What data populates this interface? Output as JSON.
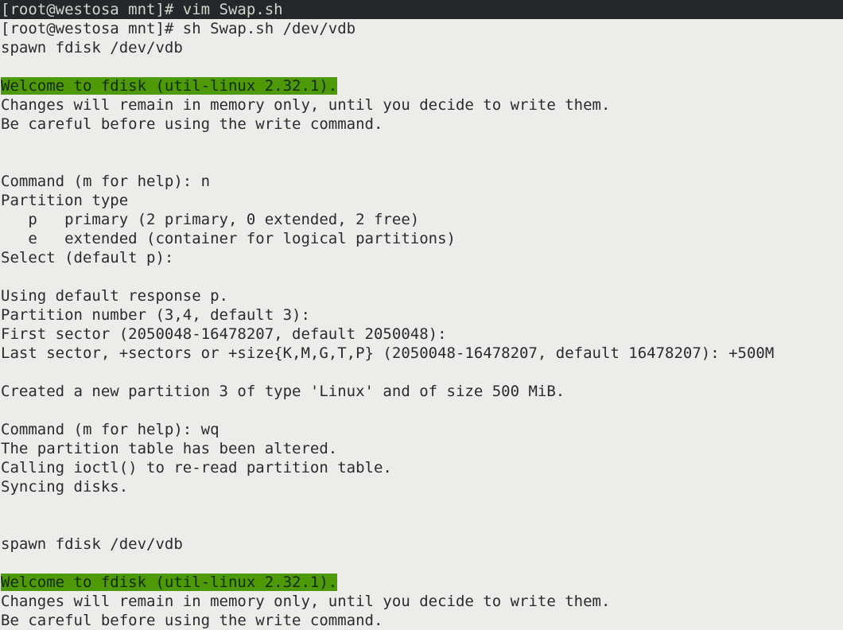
{
  "terminal": {
    "window_title": "root@westosa:/mnt",
    "colors": {
      "background": "#ececeb",
      "foreground": "#2b2b2b",
      "active_line_background": "#24282a",
      "active_line_foreground": "#d3d7cf",
      "highlight_green_background": "#4e9a06",
      "highlight_green_foreground": "#14280a"
    },
    "prompt": "[root@westosa mnt]#",
    "hostname": "westosa",
    "user": "root",
    "cwd": "mnt",
    "lines": [
      {
        "text": "[root@westosa mnt]# vim Swap.sh",
        "style": "prompt-active"
      },
      {
        "text": "[root@westosa mnt]# sh Swap.sh /dev/vdb",
        "style": "normal"
      },
      {
        "text": "spawn fdisk /dev/vdb",
        "style": "normal"
      },
      {
        "text": "",
        "style": "blank"
      },
      {
        "text": "Welcome to fdisk (util-linux 2.32.1).",
        "style": "highlight-green"
      },
      {
        "text": "Changes will remain in memory only, until you decide to write them.",
        "style": "normal"
      },
      {
        "text": "Be careful before using the write command.",
        "style": "normal"
      },
      {
        "text": "",
        "style": "blank"
      },
      {
        "text": "",
        "style": "blank"
      },
      {
        "text": "Command (m for help): n",
        "style": "normal"
      },
      {
        "text": "Partition type",
        "style": "normal"
      },
      {
        "text": "   p   primary (2 primary, 0 extended, 2 free)",
        "style": "normal"
      },
      {
        "text": "   e   extended (container for logical partitions)",
        "style": "normal"
      },
      {
        "text": "Select (default p):",
        "style": "normal"
      },
      {
        "text": "",
        "style": "blank"
      },
      {
        "text": "Using default response p.",
        "style": "normal"
      },
      {
        "text": "Partition number (3,4, default 3):",
        "style": "normal"
      },
      {
        "text": "First sector (2050048-16478207, default 2050048):",
        "style": "normal"
      },
      {
        "text": "Last sector, +sectors or +size{K,M,G,T,P} (2050048-16478207, default 16478207): +500M",
        "style": "normal"
      },
      {
        "text": "",
        "style": "blank"
      },
      {
        "text": "Created a new partition 3 of type 'Linux' and of size 500 MiB.",
        "style": "normal"
      },
      {
        "text": "",
        "style": "blank"
      },
      {
        "text": "Command (m for help): wq",
        "style": "normal"
      },
      {
        "text": "The partition table has been altered.",
        "style": "normal"
      },
      {
        "text": "Calling ioctl() to re-read partition table.",
        "style": "normal"
      },
      {
        "text": "Syncing disks.",
        "style": "normal"
      },
      {
        "text": "",
        "style": "blank"
      },
      {
        "text": "",
        "style": "blank"
      },
      {
        "text": "spawn fdisk /dev/vdb",
        "style": "normal"
      },
      {
        "text": "",
        "style": "blank"
      },
      {
        "text": "Welcome to fdisk (util-linux 2.32.1).",
        "style": "highlight-green"
      },
      {
        "text": "Changes will remain in memory only, until you decide to write them.",
        "style": "normal"
      },
      {
        "text": "Be careful before using the write command.",
        "style": "normal"
      }
    ]
  }
}
